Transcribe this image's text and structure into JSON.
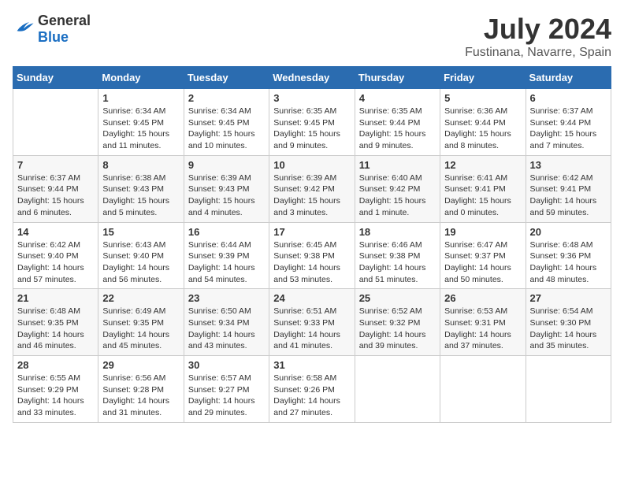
{
  "logo": {
    "text_general": "General",
    "text_blue": "Blue"
  },
  "header": {
    "month": "July 2024",
    "location": "Fustinana, Navarre, Spain"
  },
  "weekdays": [
    "Sunday",
    "Monday",
    "Tuesday",
    "Wednesday",
    "Thursday",
    "Friday",
    "Saturday"
  ],
  "weeks": [
    [
      {
        "day": "",
        "info": ""
      },
      {
        "day": "1",
        "info": "Sunrise: 6:34 AM\nSunset: 9:45 PM\nDaylight: 15 hours\nand 11 minutes."
      },
      {
        "day": "2",
        "info": "Sunrise: 6:34 AM\nSunset: 9:45 PM\nDaylight: 15 hours\nand 10 minutes."
      },
      {
        "day": "3",
        "info": "Sunrise: 6:35 AM\nSunset: 9:45 PM\nDaylight: 15 hours\nand 9 minutes."
      },
      {
        "day": "4",
        "info": "Sunrise: 6:35 AM\nSunset: 9:44 PM\nDaylight: 15 hours\nand 9 minutes."
      },
      {
        "day": "5",
        "info": "Sunrise: 6:36 AM\nSunset: 9:44 PM\nDaylight: 15 hours\nand 8 minutes."
      },
      {
        "day": "6",
        "info": "Sunrise: 6:37 AM\nSunset: 9:44 PM\nDaylight: 15 hours\nand 7 minutes."
      }
    ],
    [
      {
        "day": "7",
        "info": "Sunrise: 6:37 AM\nSunset: 9:44 PM\nDaylight: 15 hours\nand 6 minutes."
      },
      {
        "day": "8",
        "info": "Sunrise: 6:38 AM\nSunset: 9:43 PM\nDaylight: 15 hours\nand 5 minutes."
      },
      {
        "day": "9",
        "info": "Sunrise: 6:39 AM\nSunset: 9:43 PM\nDaylight: 15 hours\nand 4 minutes."
      },
      {
        "day": "10",
        "info": "Sunrise: 6:39 AM\nSunset: 9:42 PM\nDaylight: 15 hours\nand 3 minutes."
      },
      {
        "day": "11",
        "info": "Sunrise: 6:40 AM\nSunset: 9:42 PM\nDaylight: 15 hours\nand 1 minute."
      },
      {
        "day": "12",
        "info": "Sunrise: 6:41 AM\nSunset: 9:41 PM\nDaylight: 15 hours\nand 0 minutes."
      },
      {
        "day": "13",
        "info": "Sunrise: 6:42 AM\nSunset: 9:41 PM\nDaylight: 14 hours\nand 59 minutes."
      }
    ],
    [
      {
        "day": "14",
        "info": "Sunrise: 6:42 AM\nSunset: 9:40 PM\nDaylight: 14 hours\nand 57 minutes."
      },
      {
        "day": "15",
        "info": "Sunrise: 6:43 AM\nSunset: 9:40 PM\nDaylight: 14 hours\nand 56 minutes."
      },
      {
        "day": "16",
        "info": "Sunrise: 6:44 AM\nSunset: 9:39 PM\nDaylight: 14 hours\nand 54 minutes."
      },
      {
        "day": "17",
        "info": "Sunrise: 6:45 AM\nSunset: 9:38 PM\nDaylight: 14 hours\nand 53 minutes."
      },
      {
        "day": "18",
        "info": "Sunrise: 6:46 AM\nSunset: 9:38 PM\nDaylight: 14 hours\nand 51 minutes."
      },
      {
        "day": "19",
        "info": "Sunrise: 6:47 AM\nSunset: 9:37 PM\nDaylight: 14 hours\nand 50 minutes."
      },
      {
        "day": "20",
        "info": "Sunrise: 6:48 AM\nSunset: 9:36 PM\nDaylight: 14 hours\nand 48 minutes."
      }
    ],
    [
      {
        "day": "21",
        "info": "Sunrise: 6:48 AM\nSunset: 9:35 PM\nDaylight: 14 hours\nand 46 minutes."
      },
      {
        "day": "22",
        "info": "Sunrise: 6:49 AM\nSunset: 9:35 PM\nDaylight: 14 hours\nand 45 minutes."
      },
      {
        "day": "23",
        "info": "Sunrise: 6:50 AM\nSunset: 9:34 PM\nDaylight: 14 hours\nand 43 minutes."
      },
      {
        "day": "24",
        "info": "Sunrise: 6:51 AM\nSunset: 9:33 PM\nDaylight: 14 hours\nand 41 minutes."
      },
      {
        "day": "25",
        "info": "Sunrise: 6:52 AM\nSunset: 9:32 PM\nDaylight: 14 hours\nand 39 minutes."
      },
      {
        "day": "26",
        "info": "Sunrise: 6:53 AM\nSunset: 9:31 PM\nDaylight: 14 hours\nand 37 minutes."
      },
      {
        "day": "27",
        "info": "Sunrise: 6:54 AM\nSunset: 9:30 PM\nDaylight: 14 hours\nand 35 minutes."
      }
    ],
    [
      {
        "day": "28",
        "info": "Sunrise: 6:55 AM\nSunset: 9:29 PM\nDaylight: 14 hours\nand 33 minutes."
      },
      {
        "day": "29",
        "info": "Sunrise: 6:56 AM\nSunset: 9:28 PM\nDaylight: 14 hours\nand 31 minutes."
      },
      {
        "day": "30",
        "info": "Sunrise: 6:57 AM\nSunset: 9:27 PM\nDaylight: 14 hours\nand 29 minutes."
      },
      {
        "day": "31",
        "info": "Sunrise: 6:58 AM\nSunset: 9:26 PM\nDaylight: 14 hours\nand 27 minutes."
      },
      {
        "day": "",
        "info": ""
      },
      {
        "day": "",
        "info": ""
      },
      {
        "day": "",
        "info": ""
      }
    ]
  ]
}
